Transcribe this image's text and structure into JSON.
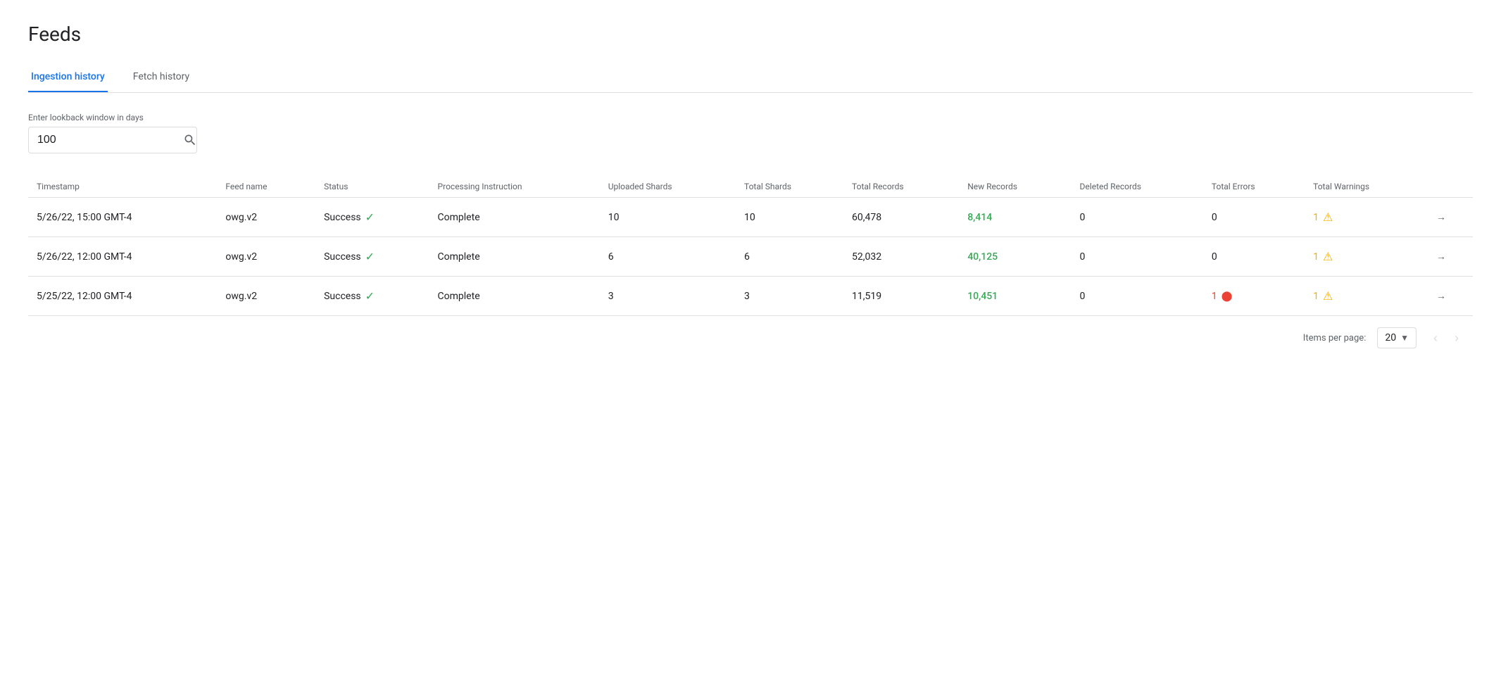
{
  "page": {
    "title": "Feeds"
  },
  "tabs": [
    {
      "id": "ingestion",
      "label": "Ingestion history",
      "active": true
    },
    {
      "id": "fetch",
      "label": "Fetch history",
      "active": false
    }
  ],
  "lookback": {
    "label": "Enter lookback window in days",
    "value": "100"
  },
  "table": {
    "columns": [
      {
        "id": "timestamp",
        "label": "Timestamp"
      },
      {
        "id": "feed_name",
        "label": "Feed name"
      },
      {
        "id": "status",
        "label": "Status"
      },
      {
        "id": "processing_instruction",
        "label": "Processing Instruction"
      },
      {
        "id": "uploaded_shards",
        "label": "Uploaded Shards"
      },
      {
        "id": "total_shards",
        "label": "Total Shards"
      },
      {
        "id": "total_records",
        "label": "Total Records"
      },
      {
        "id": "new_records",
        "label": "New Records"
      },
      {
        "id": "deleted_records",
        "label": "Deleted Records"
      },
      {
        "id": "total_errors",
        "label": "Total Errors"
      },
      {
        "id": "total_warnings",
        "label": "Total Warnings"
      },
      {
        "id": "action",
        "label": ""
      }
    ],
    "rows": [
      {
        "timestamp": "5/26/22, 15:00 GMT-4",
        "feed_name": "owg.v2",
        "status": "Success",
        "processing_instruction": "Complete",
        "uploaded_shards": "10",
        "total_shards": "10",
        "total_records": "60,478",
        "new_records": "8,414",
        "deleted_records": "0",
        "total_errors": "0",
        "total_warnings": "1",
        "has_warning": true,
        "has_error": false
      },
      {
        "timestamp": "5/26/22, 12:00 GMT-4",
        "feed_name": "owg.v2",
        "status": "Success",
        "processing_instruction": "Complete",
        "uploaded_shards": "6",
        "total_shards": "6",
        "total_records": "52,032",
        "new_records": "40,125",
        "deleted_records": "0",
        "total_errors": "0",
        "total_warnings": "1",
        "has_warning": true,
        "has_error": false
      },
      {
        "timestamp": "5/25/22, 12:00 GMT-4",
        "feed_name": "owg.v2",
        "status": "Success",
        "processing_instruction": "Complete",
        "uploaded_shards": "3",
        "total_shards": "3",
        "total_records": "11,519",
        "new_records": "10,451",
        "deleted_records": "0",
        "total_errors": "1",
        "total_warnings": "1",
        "has_warning": true,
        "has_error": true
      }
    ]
  },
  "pagination": {
    "items_per_page_label": "Items per page:",
    "items_per_page_value": "20",
    "prev_disabled": true,
    "next_disabled": true
  }
}
